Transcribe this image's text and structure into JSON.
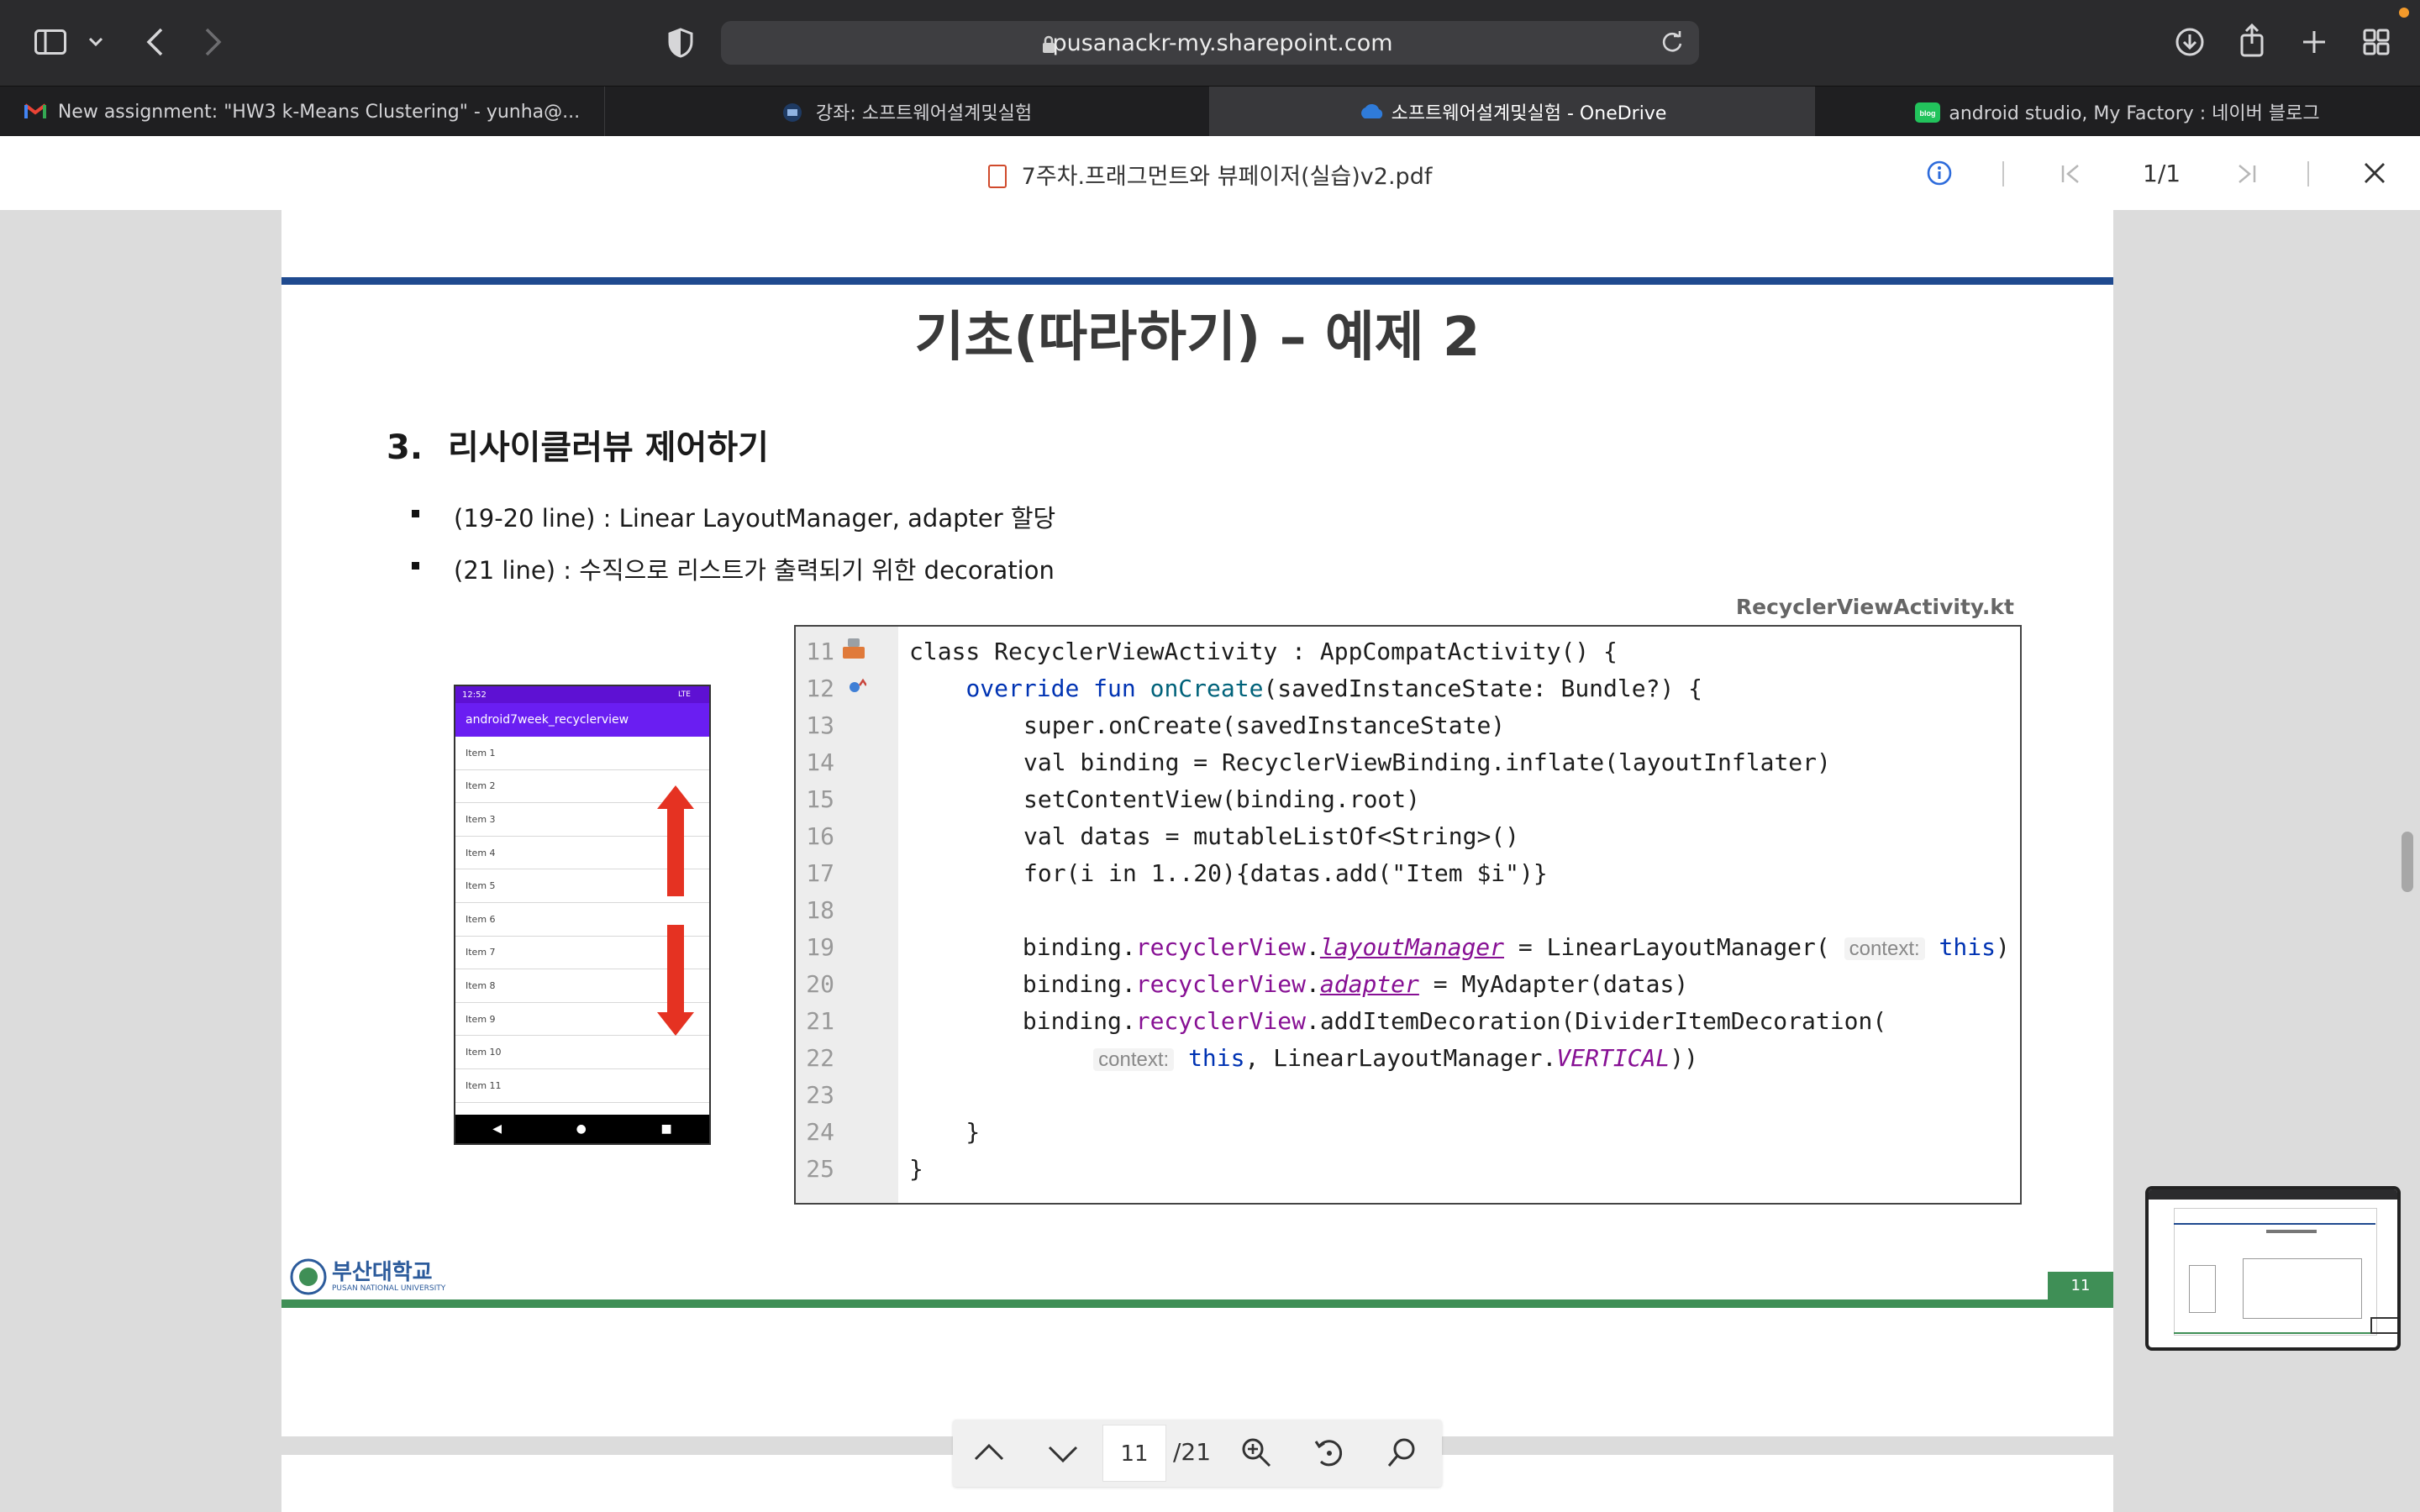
{
  "browser": {
    "url": "pusanackr-my.sharepoint.com",
    "tabs": [
      {
        "title": "New assignment: \"HW3 k-Means Clustering\" - yunha@...",
        "active": false
      },
      {
        "title": "강좌: 소프트웨어설계및실험",
        "active": false
      },
      {
        "title": "소프트웨어설계및실험 - OneDrive",
        "active": true
      },
      {
        "title": "android studio, My Factory : 네이버 블로그",
        "active": false
      }
    ],
    "favicon_labels": {
      "blog": "blog"
    }
  },
  "pdf_header": {
    "file_name": "7주차.프래그먼트와 뷰페이저(실습)v2.pdf",
    "page_indicator": "1/1"
  },
  "slide": {
    "title": "기초(따라하기) – 예제 2",
    "section_number": "3.",
    "section_title": "리사이클러뷰 제어하기",
    "bullets": [
      "(19-20 line) : Linear LayoutManager, adapter 할당",
      "(21 line) : 수직으로 리스트가 출력되기 위한 decoration"
    ],
    "code_file": "RecyclerViewActivity.kt",
    "phone": {
      "time": "12:52",
      "signal": "LTE",
      "app_title": "android7week_recyclerview",
      "items": [
        "Item 1",
        "Item 2",
        "Item 3",
        "Item 4",
        "Item 5",
        "Item 6",
        "Item 7",
        "Item 8",
        "Item 9",
        "Item 10",
        "Item 11"
      ]
    },
    "code_line_numbers": [
      "11",
      "12",
      "13",
      "14",
      "15",
      "16",
      "17",
      "18",
      "19",
      "20",
      "21",
      "22",
      "23",
      "24",
      "25"
    ],
    "code_text": {
      "l11": "class RecyclerViewActivity : AppCompatActivity() {",
      "l13": "super.onCreate(savedInstanceState)",
      "l14": "val binding = RecyclerViewBinding.inflate(layoutInflater)",
      "l15": "setContentView(binding.root)",
      "l16": "val datas = mutableListOf<String>()",
      "l17": "for(i in 1..20){datas.add(\"Item $i\")}",
      "hint_context": "context:"
    },
    "university": {
      "name_ko": "부산대학교",
      "name_en": "PUSAN NATIONAL UNIVERSITY"
    },
    "page_number": "11"
  },
  "pager": {
    "current_page": "11",
    "total": "/21"
  },
  "colors": {
    "title_rule": "#1f4a8f",
    "footer_rule": "#3f8f56",
    "phone_appbar": "#6a1ef2",
    "arrow": "#e53222"
  }
}
